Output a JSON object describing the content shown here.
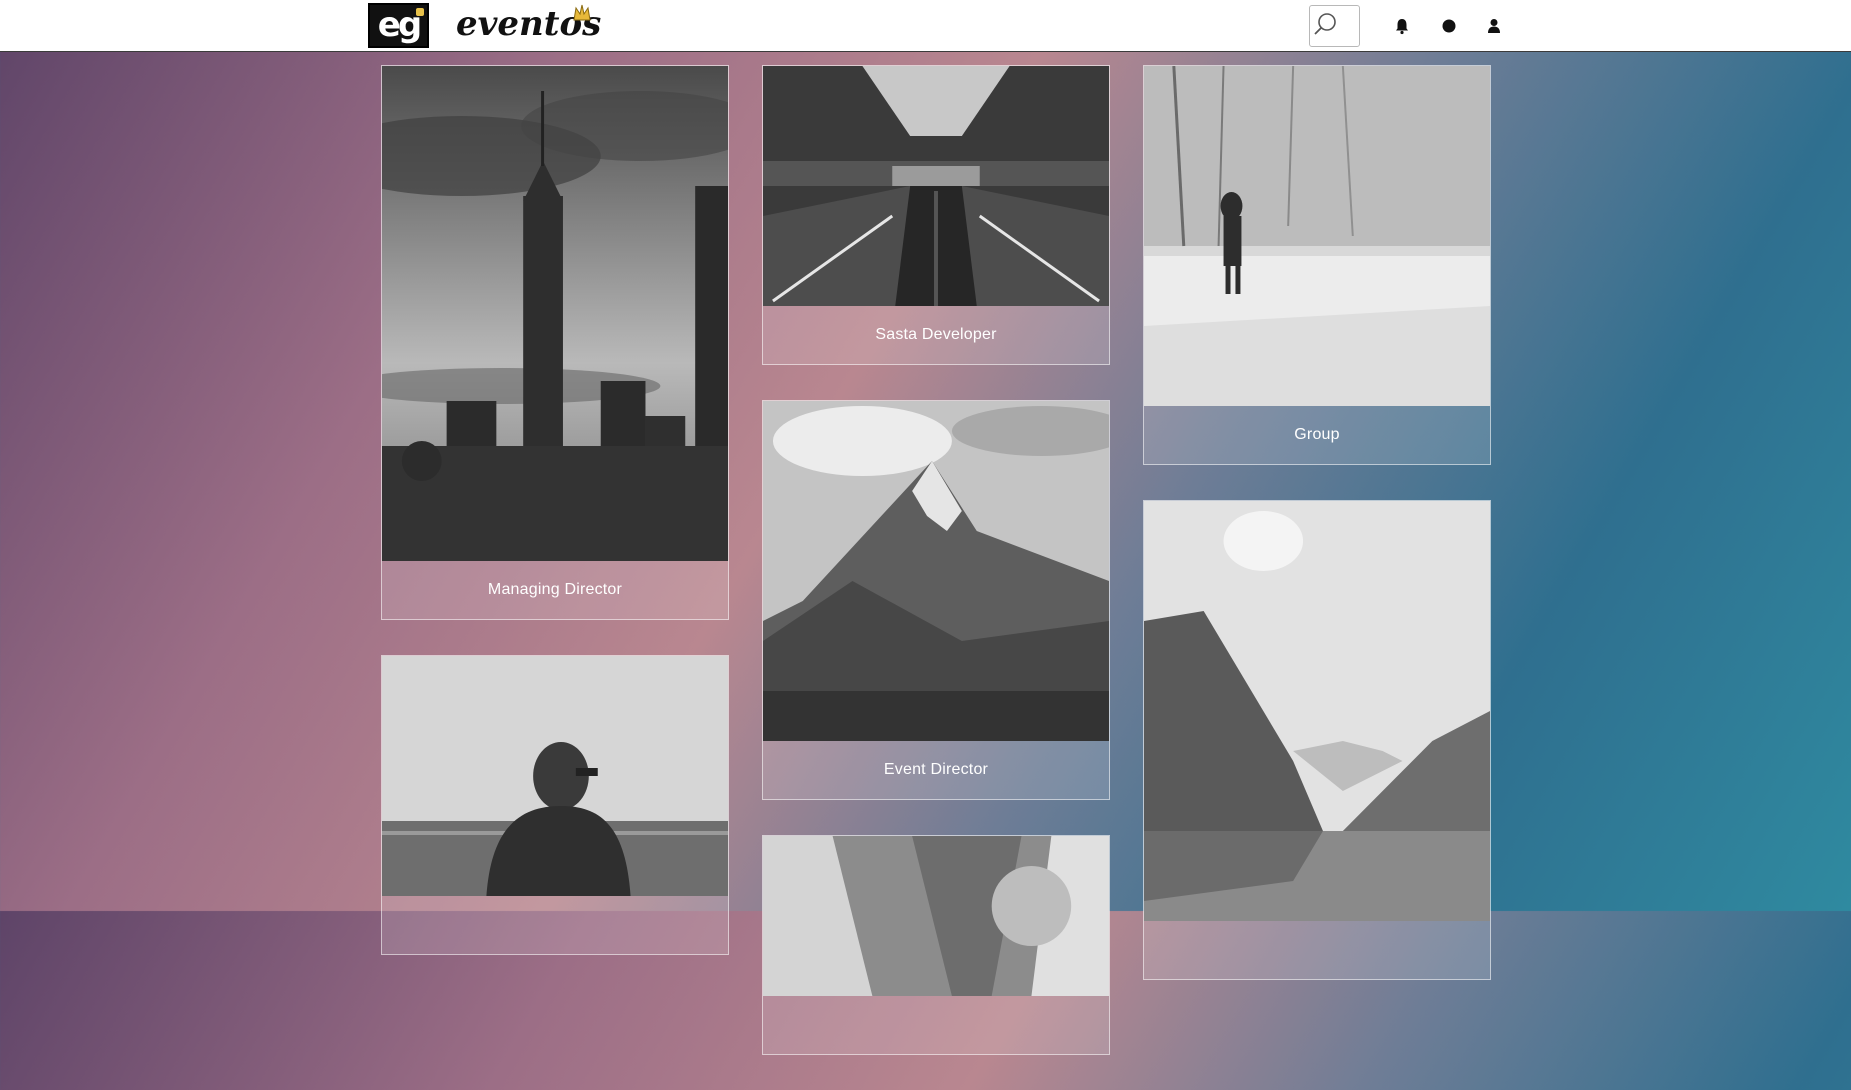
{
  "brand": {
    "mark_text": "eg",
    "name": "eventos"
  },
  "colors": {
    "header_bg": "#ffffff",
    "caption_text": "#ffffff",
    "gradient_start": "#5e4468",
    "gradient_end": "#2f8aa0"
  },
  "nav": {
    "icons": [
      "search-icon",
      "bell-icon",
      "circle-icon",
      "user-icon"
    ]
  },
  "cards": [
    {
      "caption": "Managing Director",
      "photo": "city-tower-silhouette"
    },
    {
      "caption": "",
      "photo": "person-by-the-sea"
    },
    {
      "caption": "Sasta Developer",
      "photo": "escalators"
    },
    {
      "caption": "Event Director",
      "photo": "mountain-peak"
    },
    {
      "caption": "",
      "photo": "aerial-buildings"
    },
    {
      "caption": "Group",
      "photo": "person-in-snowy-field"
    },
    {
      "caption": "",
      "photo": "mountain-lake"
    }
  ]
}
